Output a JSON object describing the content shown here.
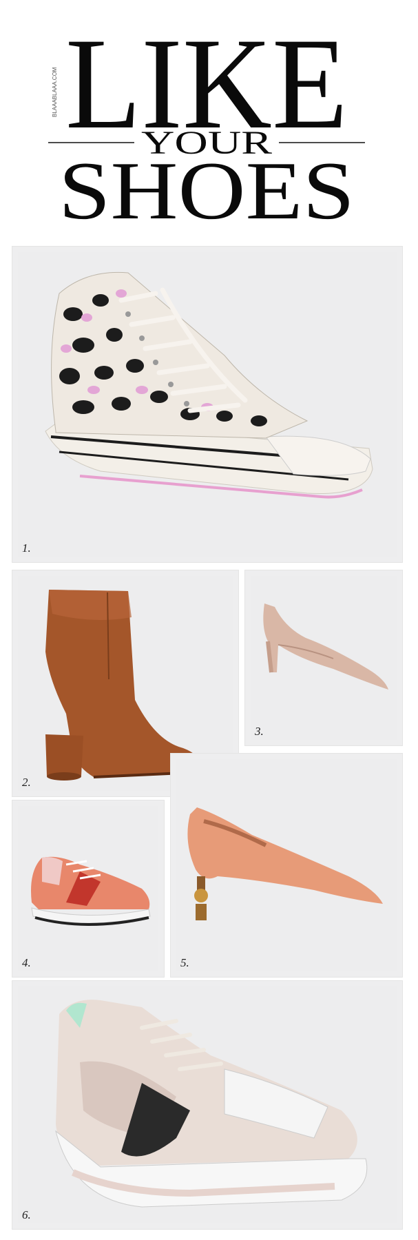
{
  "header": {
    "like": "LIKE",
    "your": "YOUR",
    "shoes": "SHOES",
    "site": "BLAAABLAAA.COM"
  },
  "items": [
    {
      "number": "1.",
      "image": "leopard-high-top-sneaker-image",
      "colors": [
        "#1c1c1c",
        "#e3a6d6",
        "#efe9e1"
      ]
    },
    {
      "number": "2.",
      "image": "brown-ankle-boot-image",
      "colors": [
        "#9b4f25",
        "#c06a37"
      ]
    },
    {
      "number": "3.",
      "image": "nude-pointed-pump-image",
      "colors": [
        "#d9b7a6"
      ]
    },
    {
      "number": "4.",
      "image": "orange-running-sneaker-image",
      "colors": [
        "#e8876b",
        "#c2362c",
        "#f0c9c6"
      ]
    },
    {
      "number": "5.",
      "image": "peach-kitten-heel-pump-image",
      "colors": [
        "#e79b78",
        "#c9953e"
      ]
    },
    {
      "number": "6.",
      "image": "chunky-pastel-sneaker-image",
      "colors": [
        "#d9c7bf",
        "#b1e6cf",
        "#2a2a2a"
      ]
    }
  ]
}
